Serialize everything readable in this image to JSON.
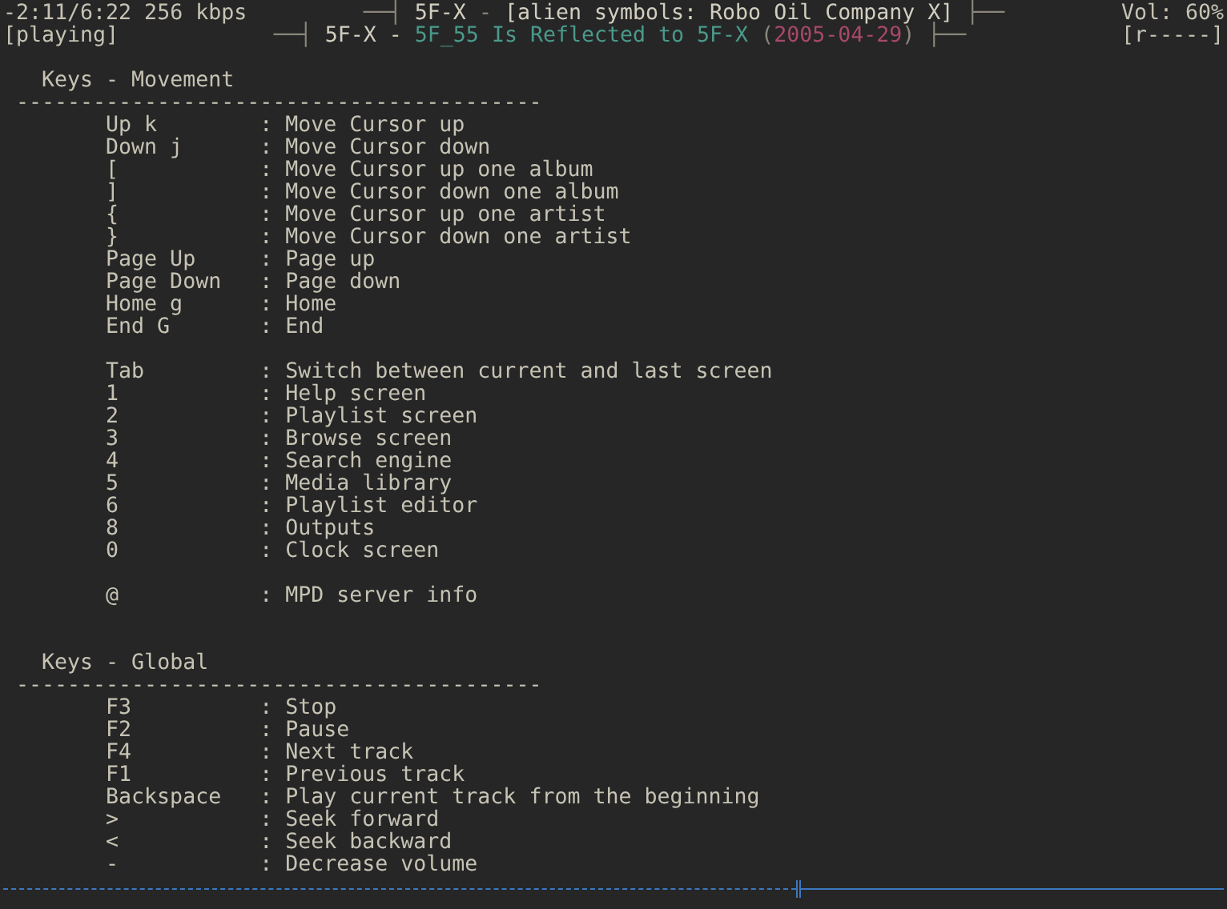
{
  "header": {
    "time": "-2:11/6:22 256 kbps",
    "state": "[playing]",
    "volume": "Vol: 60%",
    "flags": "[r-----]",
    "line_1": [
      {
        "kind": "cap",
        "text": "──┤"
      },
      {
        "kind": "artist",
        "text": "5F-X"
      },
      {
        "kind": "punct",
        "text": "-"
      },
      {
        "kind": "album",
        "text": "[alien symbols: Robo Oil Company X]"
      },
      {
        "kind": "cap",
        "text": "├──"
      }
    ],
    "line_2": [
      {
        "kind": "cap",
        "text": "──┤"
      },
      {
        "kind": "artist",
        "text": "5F-X"
      },
      {
        "kind": "album",
        "text": "-"
      },
      {
        "kind": "title",
        "text": "5F_55 Is Reflected to 5F-X"
      },
      {
        "kind": "date_group",
        "parts": [
          {
            "kind": "punct",
            "text": "("
          },
          {
            "kind": "date",
            "text": "2005-04-29"
          },
          {
            "kind": "punct",
            "text": ")"
          }
        ]
      },
      {
        "kind": "cap",
        "text": "├──"
      }
    ]
  },
  "sections": [
    {
      "title": "Keys - Movement",
      "rule": "-----------------------------------------",
      "groups": [
        [
          {
            "key": "Up k",
            "sep": ":",
            "action": "Move Cursor up"
          },
          {
            "key": "Down j",
            "sep": ":",
            "action": "Move Cursor down"
          },
          {
            "key": "[",
            "sep": ":",
            "action": "Move Cursor up one album"
          },
          {
            "key": "]",
            "sep": ":",
            "action": "Move Cursor down one album"
          },
          {
            "key": "{",
            "sep": ":",
            "action": "Move Cursor up one artist"
          },
          {
            "key": "}",
            "sep": ":",
            "action": "Move Cursor down one artist"
          },
          {
            "key": "Page Up",
            "sep": ":",
            "action": "Page up"
          },
          {
            "key": "Page Down",
            "sep": ":",
            "action": "Page down"
          },
          {
            "key": "Home g",
            "sep": ":",
            "action": "Home"
          },
          {
            "key": "End G",
            "sep": ":",
            "action": "End"
          }
        ],
        [
          {
            "key": "Tab",
            "sep": ":",
            "action": "Switch between current and last screen"
          },
          {
            "key": "1",
            "sep": ":",
            "action": "Help screen"
          },
          {
            "key": "2",
            "sep": ":",
            "action": "Playlist screen"
          },
          {
            "key": "3",
            "sep": ":",
            "action": "Browse screen"
          },
          {
            "key": "4",
            "sep": ":",
            "action": "Search engine"
          },
          {
            "key": "5",
            "sep": ":",
            "action": "Media library"
          },
          {
            "key": "6",
            "sep": ":",
            "action": "Playlist editor"
          },
          {
            "key": "8",
            "sep": ":",
            "action": "Outputs"
          },
          {
            "key": "0",
            "sep": ":",
            "action": "Clock screen"
          }
        ],
        [
          {
            "key": "@",
            "sep": ":",
            "action": "MPD server info"
          }
        ]
      ]
    },
    {
      "title": "Keys - Global",
      "rule": "-----------------------------------------",
      "groups": [
        [
          {
            "key": "F3",
            "sep": ":",
            "action": "Stop"
          },
          {
            "key": "F2",
            "sep": ":",
            "action": "Pause"
          },
          {
            "key": "F4",
            "sep": ":",
            "action": "Next track"
          },
          {
            "key": "F1",
            "sep": ":",
            "action": "Previous track"
          },
          {
            "key": "Backspace",
            "sep": ":",
            "action": "Play current track from the beginning"
          },
          {
            "key": ">",
            "sep": ":",
            "action": "Seek forward"
          },
          {
            "key": "<",
            "sep": ":",
            "action": "Seek backward"
          },
          {
            "key": "-",
            "sep": ":",
            "action": "Decrease volume"
          }
        ]
      ]
    }
  ],
  "progress": {
    "level": 0.65
  }
}
